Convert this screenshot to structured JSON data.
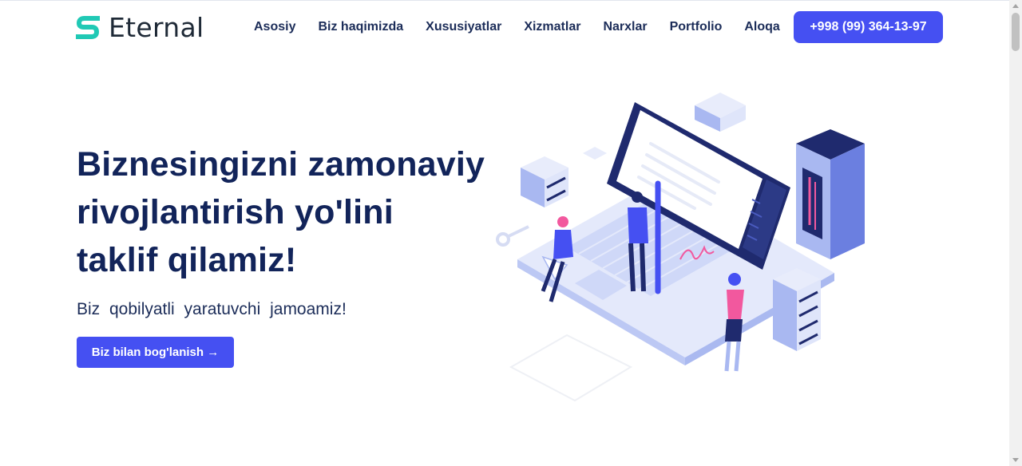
{
  "brand": {
    "name": "Eternal",
    "logo_icon": "eternal-s-logo-icon",
    "accent": "#20c9b5"
  },
  "nav": {
    "items": [
      {
        "label": "Asosiy"
      },
      {
        "label": "Biz haqimizda"
      },
      {
        "label": "Xususiyatlar"
      },
      {
        "label": "Xizmatlar"
      },
      {
        "label": "Narxlar"
      },
      {
        "label": "Portfolio"
      },
      {
        "label": "Aloqa"
      }
    ],
    "phone": "+998 (99) 364-13-97"
  },
  "hero": {
    "title_line1": "Biznesingizni zamonaviy",
    "title_line2": "rivojlantirish yo'lini",
    "title_line3": "taklif qilamiz!",
    "subtitle": "Biz qobilyatli yaratuvchi jamoamiz!",
    "cta_label": "Biz bilan bog'lanish →",
    "illustration": "isometric-laptop-team-illustration"
  },
  "colors": {
    "primary": "#4550f2",
    "heading": "#12245a",
    "text": "#1c2d59"
  }
}
